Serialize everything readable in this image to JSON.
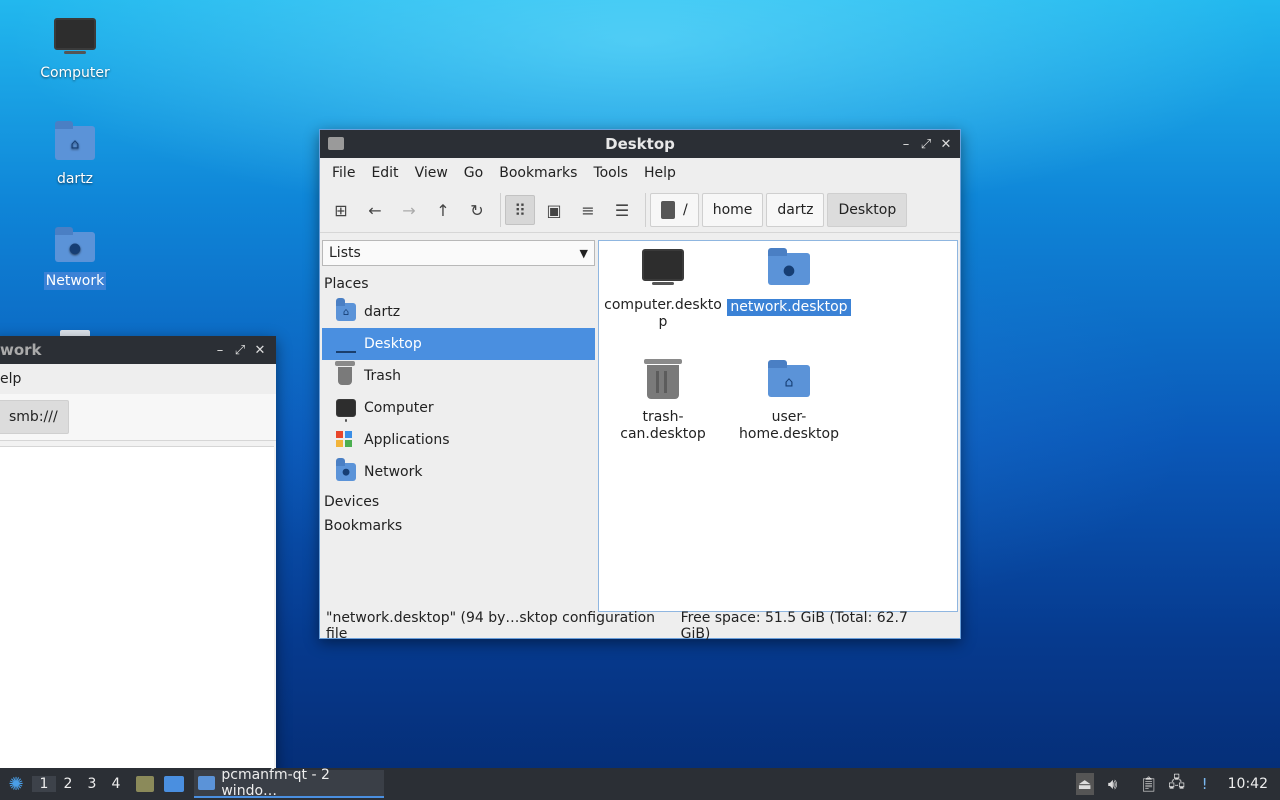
{
  "desktop": {
    "icons": [
      {
        "label": "Computer",
        "icon": "monitor-icon"
      },
      {
        "label": "dartz",
        "icon": "home-folder-icon"
      },
      {
        "label": "Network",
        "icon": "network-folder-icon"
      }
    ]
  },
  "bg_window": {
    "title": "work",
    "menu_label": "elp",
    "path_label": "smb:///"
  },
  "fm": {
    "title": "Desktop",
    "menus": [
      "File",
      "Edit",
      "View",
      "Go",
      "Bookmarks",
      "Tools",
      "Help"
    ],
    "breadcrumbs": [
      "/",
      "home",
      "dartz",
      "Desktop"
    ],
    "side_combo": "Lists",
    "sections": {
      "places": "Places",
      "devices": "Devices",
      "bookmarks": "Bookmarks"
    },
    "places": [
      {
        "label": "dartz",
        "icon": "home-folder-icon"
      },
      {
        "label": "Desktop",
        "icon": "desktop-icon"
      },
      {
        "label": "Trash",
        "icon": "trash-icon"
      },
      {
        "label": "Computer",
        "icon": "computer-icon"
      },
      {
        "label": "Applications",
        "icon": "applications-icon"
      },
      {
        "label": "Network",
        "icon": "network-folder-icon"
      }
    ],
    "files": [
      {
        "name": "computer.deskto\np",
        "icon": "monitor-icon"
      },
      {
        "name": "network.desktop",
        "icon": "network-folder-icon"
      },
      {
        "name": "trash-\ncan.desktop",
        "icon": "trash-icon"
      },
      {
        "name": "user-\nhome.desktop",
        "icon": "home-folder-icon"
      }
    ],
    "status_left": "\"network.desktop\" (94 by…sktop configuration file",
    "status_right": "Free space: 51.5 GiB (Total: 62.7 GiB)"
  },
  "taskbar": {
    "workspaces": [
      "1",
      "2",
      "3",
      "4"
    ],
    "task_label": "pcmanfm-qt - 2 windo…",
    "clock": "10:42"
  },
  "colors": {
    "accent": "#4a8fe0",
    "panel": "#2b2f35",
    "folder": "#5b93d8"
  }
}
